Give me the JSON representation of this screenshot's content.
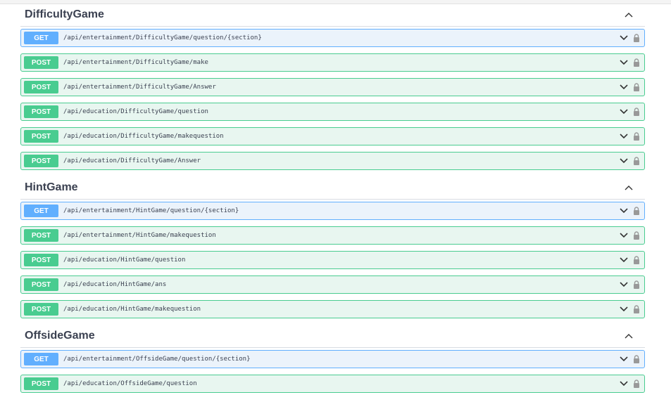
{
  "sections": [
    {
      "title": "DifficultyGame",
      "ops": [
        {
          "method": "GET",
          "path": "/api/entertainment/DifficultyGame/question/{section}"
        },
        {
          "method": "POST",
          "path": "/api/entertainment/DifficultyGame/make"
        },
        {
          "method": "POST",
          "path": "/api/entertainment/DifficultyGame/Answer"
        },
        {
          "method": "POST",
          "path": "/api/education/DifficultyGame/question"
        },
        {
          "method": "POST",
          "path": "/api/education/DifficultyGame/makequestion"
        },
        {
          "method": "POST",
          "path": "/api/education/DifficultyGame/Answer"
        }
      ]
    },
    {
      "title": "HintGame",
      "ops": [
        {
          "method": "GET",
          "path": "/api/entertainment/HintGame/question/{section}"
        },
        {
          "method": "POST",
          "path": "/api/entertainment/HintGame/makequestion"
        },
        {
          "method": "POST",
          "path": "/api/education/HintGame/question"
        },
        {
          "method": "POST",
          "path": "/api/education/HintGame/ans"
        },
        {
          "method": "POST",
          "path": "/api/education/HintGame/makequestion"
        }
      ]
    },
    {
      "title": "OffsideGame",
      "ops": [
        {
          "method": "GET",
          "path": "/api/entertainment/OffsideGame/question/{section}"
        },
        {
          "method": "POST",
          "path": "/api/education/OffsideGame/question"
        }
      ]
    }
  ],
  "colors": {
    "get": "#61affe",
    "post": "#49cc90"
  }
}
